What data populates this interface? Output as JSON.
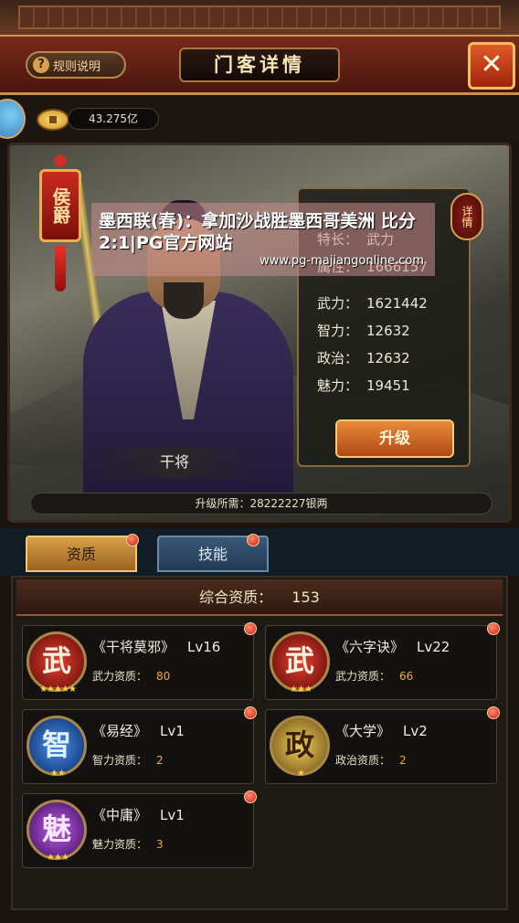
{
  "header": {
    "rules_label": "规则说明",
    "rules_icon": "question-icon",
    "title": "门客详情",
    "close_icon": "close-icon"
  },
  "currency": {
    "icon": "coin-icon",
    "amount": "43.275亿"
  },
  "hero": {
    "rank": "侯爵",
    "name": "干将",
    "detail_label": "详情",
    "upgrade_label": "升级",
    "upgrade_cost": "升级所需：28222227银两",
    "stats": [
      {
        "key": "特长：",
        "value": "武力"
      },
      {
        "key": "属性：",
        "value": "1666157"
      },
      {
        "key": "武力：",
        "value": "1621442"
      },
      {
        "key": "智力：",
        "value": "12632"
      },
      {
        "key": "政治：",
        "value": "12632"
      },
      {
        "key": "魅力：",
        "value": "19451"
      }
    ]
  },
  "watermark": {
    "title": "墨西联(春)：拿加沙战胜墨西哥美洲 比分2:1|PG官方网站",
    "url": "www.pg-majiangonline.com"
  },
  "tabs": [
    {
      "label": "资质",
      "active": true
    },
    {
      "label": "技能",
      "active": false
    }
  ],
  "summary": {
    "label": "综合资质：",
    "value": "153"
  },
  "skills": [
    {
      "icon_char": "武",
      "icon_kind": "wu",
      "name": "《干将莫邪》",
      "level": "Lv16",
      "attr": "武力资质：",
      "value": "80",
      "stars": "★★★★★"
    },
    {
      "icon_char": "武",
      "icon_kind": "wu",
      "name": "《六字诀》",
      "level": "Lv22",
      "attr": "武力资质：",
      "value": "66",
      "stars": "★★★"
    },
    {
      "icon_char": "智",
      "icon_kind": "zhi",
      "name": "《易经》",
      "level": "Lv1",
      "attr": "智力资质：",
      "value": "2",
      "stars": "★★"
    },
    {
      "icon_char": "政",
      "icon_kind": "zheng",
      "name": "《大学》",
      "level": "Lv2",
      "attr": "政治资质：",
      "value": "2",
      "stars": "★"
    },
    {
      "icon_char": "魅",
      "icon_kind": "mei",
      "name": "《中庸》",
      "level": "Lv1",
      "attr": "魅力资质：",
      "value": "3",
      "stars": "★★★"
    }
  ]
}
